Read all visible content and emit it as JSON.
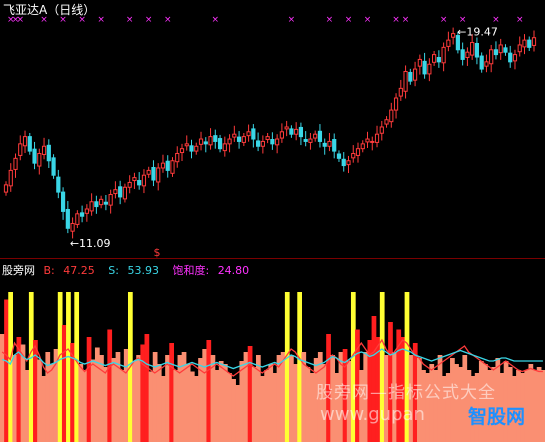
{
  "header": {
    "title": "飞亚达A（日线）"
  },
  "annotations": {
    "high_label": "19.47",
    "low_label": "11.09",
    "signal_glyph": "$"
  },
  "sub_panel": {
    "name": "股旁网",
    "b_label": "B:",
    "b_value": "47.25",
    "s_label": "S:",
    "s_value": "53.93",
    "sat_label": "饱和度:",
    "sat_value": "24.80"
  },
  "colors": {
    "up": "#ff3b3b",
    "down": "#3ad6e6",
    "marker": "#ff33ff",
    "b_color": "#ff3b3b",
    "s_color": "#3ad6e6",
    "sat_color": "#ff33ff",
    "bar_salmon": "#fa8f72",
    "bar_red": "#ff1f1f",
    "bar_yellow": "#ffff33"
  },
  "watermark": {
    "text": "股旁网—指标公式大全",
    "url": "www.gupan",
    "logo": "智股网"
  },
  "chart_data": [
    {
      "type": "candlestick",
      "title": "飞亚达A（日线）",
      "ylim": [
        10.5,
        20.2
      ],
      "annotated_high": 19.47,
      "annotated_low": 11.09,
      "closes": [
        13.2,
        13.8,
        14.3,
        14.9,
        15.2,
        14.6,
        14.1,
        14.5,
        14.8,
        14.2,
        13.6,
        12.9,
        12.1,
        11.4,
        11.6,
        12.0,
        11.9,
        12.2,
        12.5,
        12.3,
        12.6,
        12.4,
        12.8,
        13.0,
        12.7,
        13.1,
        13.3,
        13.5,
        13.2,
        13.6,
        13.8,
        13.4,
        13.9,
        14.1,
        13.8,
        14.2,
        14.5,
        14.7,
        14.9,
        14.6,
        14.8,
        15.1,
        14.9,
        15.2,
        15.0,
        14.7,
        14.9,
        15.1,
        15.3,
        15.0,
        15.2,
        15.4,
        15.1,
        14.8,
        15.0,
        15.2,
        14.9,
        15.1,
        15.4,
        15.6,
        15.3,
        15.5,
        15.2,
        15.0,
        15.1,
        15.3,
        15.0,
        14.8,
        15.0,
        14.6,
        14.3,
        14.0,
        14.2,
        14.5,
        14.7,
        14.9,
        15.1,
        15.0,
        15.3,
        15.6,
        15.9,
        16.3,
        16.8,
        17.2,
        17.9,
        17.5,
        18.0,
        18.4,
        17.8,
        18.2,
        18.6,
        18.3,
        18.9,
        19.2,
        19.47,
        18.8,
        18.4,
        18.7,
        19.1,
        18.5,
        18.0,
        18.3,
        18.8,
        18.6,
        19.0,
        18.7,
        18.3,
        18.6,
        19.0,
        19.2,
        18.9,
        19.3
      ],
      "markers_x_index": [
        1,
        2,
        3,
        8,
        12,
        16,
        20,
        26,
        30,
        34,
        44,
        60,
        68,
        72,
        76,
        82,
        84,
        92,
        96,
        103,
        108
      ]
    },
    {
      "type": "bar",
      "title": "股旁网",
      "ylim": [
        0,
        100
      ],
      "series": [
        {
          "name": "B",
          "values": [
            47.25
          ]
        },
        {
          "name": "S",
          "values": [
            53.93
          ]
        },
        {
          "name": "饱和度",
          "values": [
            24.8
          ]
        }
      ],
      "bars": [
        72,
        95,
        100,
        58,
        70,
        65,
        48,
        100,
        68,
        55,
        44,
        60,
        52,
        62,
        100,
        78,
        100,
        66,
        100,
        52,
        48,
        70,
        55,
        63,
        58,
        50,
        75,
        56,
        60,
        48,
        62,
        100,
        54,
        58,
        65,
        72,
        47,
        60,
        52,
        44,
        58,
        66,
        48,
        58,
        60,
        52,
        47,
        44,
        56,
        62,
        68,
        58,
        48,
        54,
        52,
        46,
        42,
        38,
        54,
        60,
        64,
        50,
        58,
        44,
        48,
        52,
        46,
        58,
        60,
        100,
        58,
        52,
        100,
        60,
        50,
        46,
        56,
        60,
        52,
        72,
        58,
        46,
        60,
        62,
        54,
        100,
        75,
        48,
        60,
        68,
        84,
        70,
        100,
        58,
        80,
        60,
        75,
        70,
        100,
        58,
        66,
        56,
        48,
        46,
        52,
        48,
        58,
        44,
        46,
        56,
        52,
        50,
        58,
        48,
        44,
        46,
        54,
        52,
        48,
        50,
        56,
        46,
        54,
        50,
        44,
        48,
        46,
        48,
        52,
        48,
        50,
        48
      ],
      "bar_kinds": [
        0,
        1,
        2,
        0,
        1,
        0,
        0,
        2,
        1,
        0,
        0,
        0,
        0,
        0,
        2,
        1,
        2,
        1,
        2,
        0,
        0,
        1,
        0,
        0,
        0,
        0,
        1,
        0,
        0,
        0,
        0,
        2,
        0,
        0,
        1,
        1,
        0,
        0,
        0,
        0,
        0,
        1,
        0,
        0,
        0,
        0,
        0,
        0,
        0,
        0,
        1,
        0,
        0,
        0,
        0,
        0,
        0,
        0,
        0,
        0,
        1,
        0,
        0,
        0,
        0,
        0,
        0,
        0,
        0,
        2,
        0,
        0,
        2,
        0,
        0,
        0,
        0,
        0,
        0,
        1,
        0,
        0,
        0,
        1,
        0,
        2,
        1,
        0,
        0,
        1,
        1,
        1,
        2,
        0,
        1,
        0,
        1,
        1,
        2,
        0,
        1,
        0,
        0,
        0,
        0,
        0,
        0,
        0,
        0,
        0,
        0,
        0,
        0,
        0,
        0,
        0,
        0,
        0,
        0,
        0,
        0,
        0,
        0,
        0,
        0,
        0,
        0,
        0,
        0,
        0,
        0,
        0
      ],
      "b_line": [
        60,
        58,
        55,
        66,
        62,
        58,
        54,
        60,
        64,
        58,
        50,
        46,
        48,
        52,
        58,
        60,
        62,
        58,
        54,
        50,
        47,
        50,
        52,
        50,
        48,
        46,
        50,
        52,
        50,
        48,
        46,
        50,
        54,
        56,
        52,
        50,
        48,
        46,
        48,
        50,
        52,
        50,
        48,
        46,
        48,
        50,
        52,
        50,
        48,
        46,
        48,
        50,
        52,
        50,
        48,
        46,
        44,
        46,
        48,
        50,
        52,
        50,
        48,
        46,
        48,
        50,
        52,
        50,
        54,
        58,
        62,
        60,
        56,
        52,
        50,
        48,
        46,
        48,
        50,
        54,
        58,
        56,
        52,
        50,
        54,
        58,
        62,
        66,
        62,
        58,
        60,
        64,
        68,
        62,
        58,
        60,
        64,
        68,
        66,
        62,
        58,
        56,
        52,
        50,
        48,
        50,
        52,
        54,
        56,
        58,
        60,
        62,
        64,
        60,
        58,
        56,
        54,
        52,
        50,
        48,
        50,
        52,
        54,
        52,
        50,
        48,
        47,
        48,
        49,
        48,
        47,
        47
      ],
      "s_line": [
        55,
        54,
        52,
        58,
        60,
        57,
        55,
        56,
        58,
        56,
        53,
        51,
        52,
        53,
        55,
        56,
        57,
        56,
        55,
        53,
        52,
        53,
        54,
        53,
        52,
        51,
        52,
        53,
        52,
        51,
        50,
        52,
        54,
        55,
        54,
        52,
        51,
        50,
        51,
        52,
        53,
        52,
        51,
        50,
        51,
        52,
        53,
        52,
        51,
        50,
        51,
        52,
        53,
        52,
        51,
        50,
        49,
        50,
        51,
        52,
        53,
        52,
        51,
        50,
        51,
        52,
        53,
        52,
        54,
        56,
        58,
        57,
        55,
        54,
        53,
        52,
        51,
        52,
        53,
        55,
        57,
        56,
        54,
        53,
        55,
        57,
        59,
        60,
        59,
        57,
        58,
        60,
        62,
        60,
        58,
        59,
        61,
        62,
        61,
        60,
        58,
        57,
        56,
        55,
        54,
        55,
        56,
        57,
        58,
        59,
        60,
        61,
        60,
        59,
        58,
        57,
        56,
        55,
        54,
        54,
        55,
        56,
        56,
        55,
        54,
        54,
        54,
        54,
        54,
        54,
        54,
        54
      ]
    }
  ]
}
